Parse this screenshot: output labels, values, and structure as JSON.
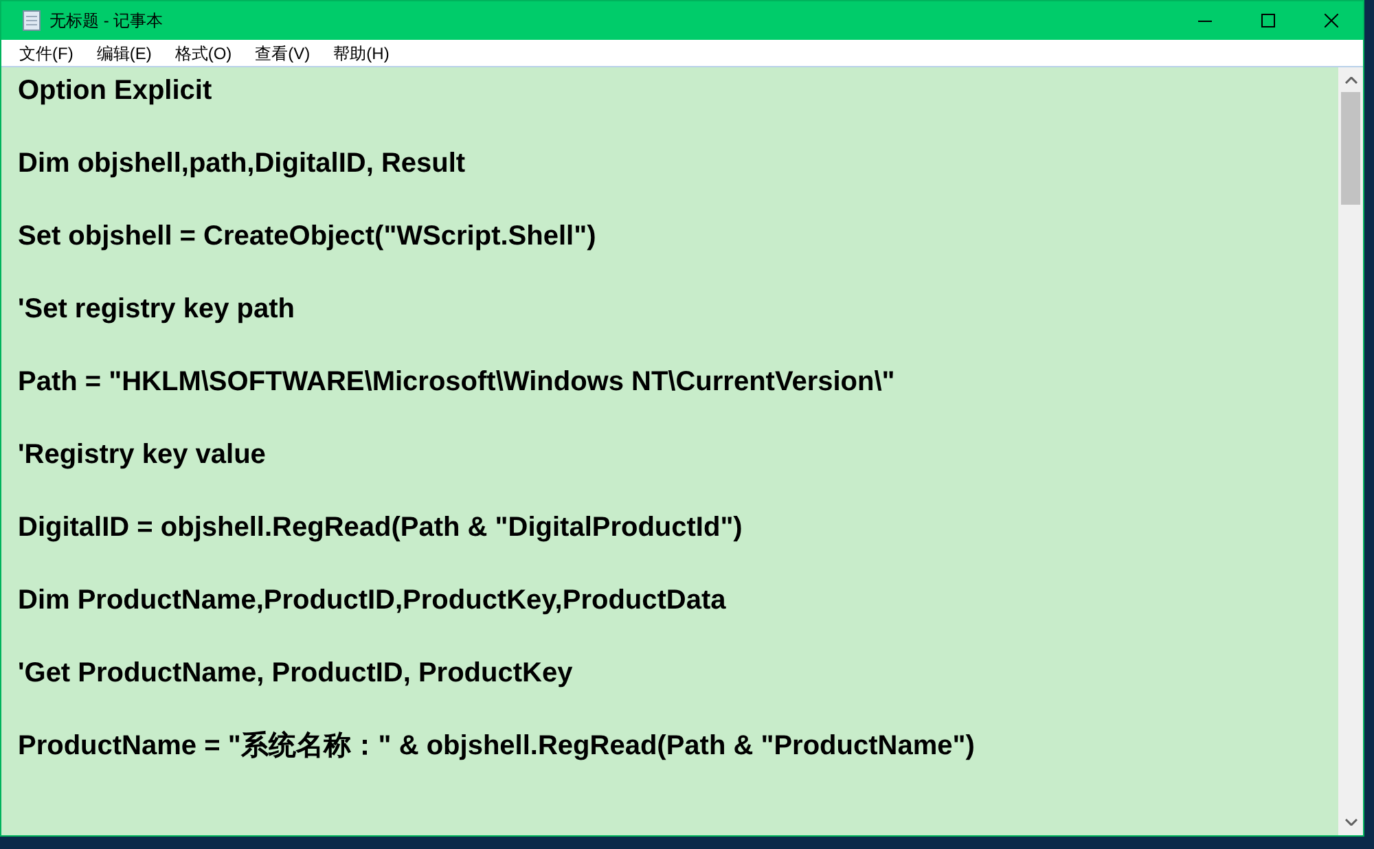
{
  "window": {
    "title": "无标题 - 记事本"
  },
  "menu": [
    "文件(F)",
    "编辑(E)",
    "格式(O)",
    "查看(V)",
    "帮助(H)"
  ],
  "lines": [
    "Option Explicit",
    "Dim objshell,path,DigitalID, Result",
    "Set objshell = CreateObject(\"WScript.Shell\")",
    "'Set registry key path",
    "Path = \"HKLM\\SOFTWARE\\Microsoft\\Windows NT\\CurrentVersion\\\"",
    "'Registry key value",
    "DigitalID = objshell.RegRead(Path & \"DigitalProductId\")",
    "Dim ProductName,ProductID,ProductKey,ProductData",
    "'Get ProductName, ProductID, ProductKey",
    "ProductName = \"系统名称：\" & objshell.RegRead(Path & \"ProductName\")"
  ]
}
